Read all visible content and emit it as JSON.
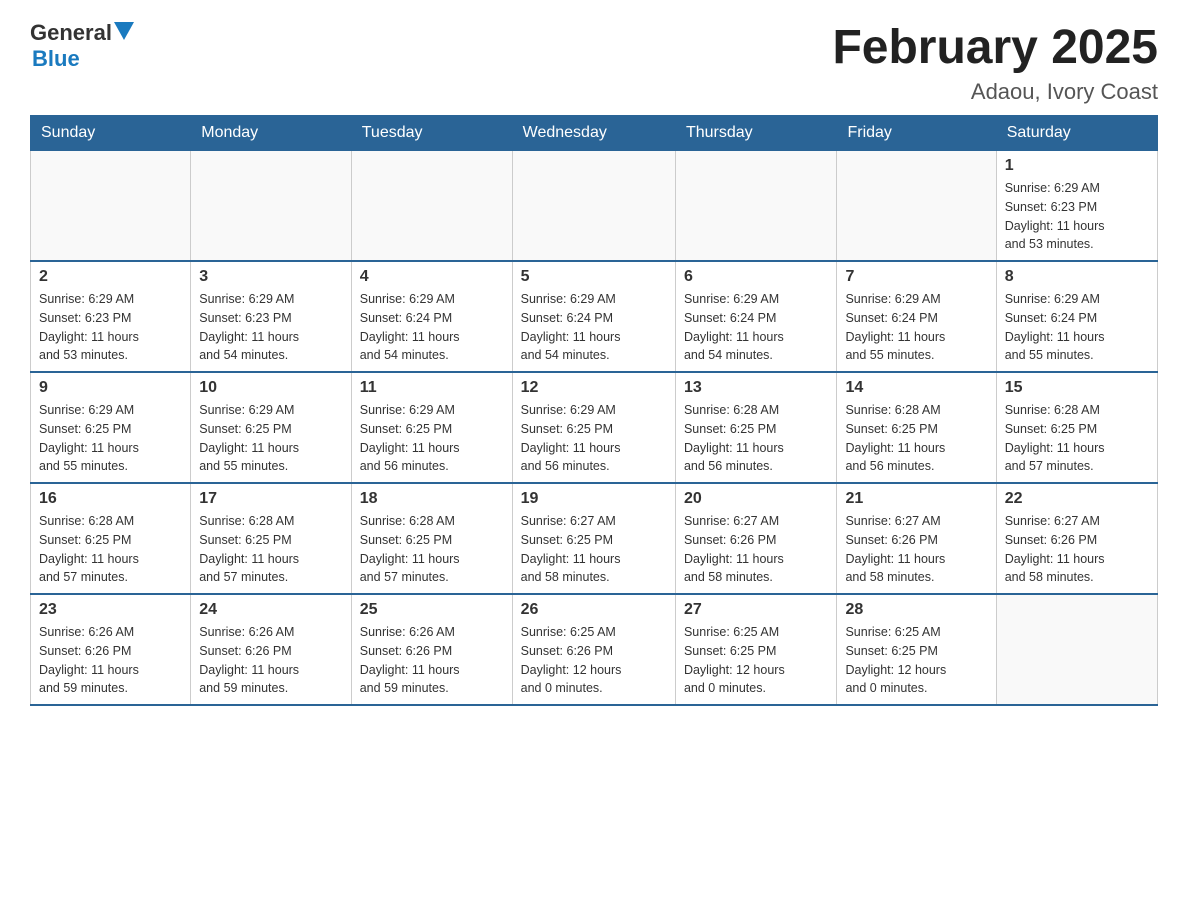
{
  "header": {
    "logo_general": "General",
    "logo_blue": "Blue",
    "month_title": "February 2025",
    "subtitle": "Adaou, Ivory Coast"
  },
  "weekdays": [
    "Sunday",
    "Monday",
    "Tuesday",
    "Wednesday",
    "Thursday",
    "Friday",
    "Saturday"
  ],
  "weeks": [
    [
      {
        "day": "",
        "info": ""
      },
      {
        "day": "",
        "info": ""
      },
      {
        "day": "",
        "info": ""
      },
      {
        "day": "",
        "info": ""
      },
      {
        "day": "",
        "info": ""
      },
      {
        "day": "",
        "info": ""
      },
      {
        "day": "1",
        "info": "Sunrise: 6:29 AM\nSunset: 6:23 PM\nDaylight: 11 hours\nand 53 minutes."
      }
    ],
    [
      {
        "day": "2",
        "info": "Sunrise: 6:29 AM\nSunset: 6:23 PM\nDaylight: 11 hours\nand 53 minutes."
      },
      {
        "day": "3",
        "info": "Sunrise: 6:29 AM\nSunset: 6:23 PM\nDaylight: 11 hours\nand 54 minutes."
      },
      {
        "day": "4",
        "info": "Sunrise: 6:29 AM\nSunset: 6:24 PM\nDaylight: 11 hours\nand 54 minutes."
      },
      {
        "day": "5",
        "info": "Sunrise: 6:29 AM\nSunset: 6:24 PM\nDaylight: 11 hours\nand 54 minutes."
      },
      {
        "day": "6",
        "info": "Sunrise: 6:29 AM\nSunset: 6:24 PM\nDaylight: 11 hours\nand 54 minutes."
      },
      {
        "day": "7",
        "info": "Sunrise: 6:29 AM\nSunset: 6:24 PM\nDaylight: 11 hours\nand 55 minutes."
      },
      {
        "day": "8",
        "info": "Sunrise: 6:29 AM\nSunset: 6:24 PM\nDaylight: 11 hours\nand 55 minutes."
      }
    ],
    [
      {
        "day": "9",
        "info": "Sunrise: 6:29 AM\nSunset: 6:25 PM\nDaylight: 11 hours\nand 55 minutes."
      },
      {
        "day": "10",
        "info": "Sunrise: 6:29 AM\nSunset: 6:25 PM\nDaylight: 11 hours\nand 55 minutes."
      },
      {
        "day": "11",
        "info": "Sunrise: 6:29 AM\nSunset: 6:25 PM\nDaylight: 11 hours\nand 56 minutes."
      },
      {
        "day": "12",
        "info": "Sunrise: 6:29 AM\nSunset: 6:25 PM\nDaylight: 11 hours\nand 56 minutes."
      },
      {
        "day": "13",
        "info": "Sunrise: 6:28 AM\nSunset: 6:25 PM\nDaylight: 11 hours\nand 56 minutes."
      },
      {
        "day": "14",
        "info": "Sunrise: 6:28 AM\nSunset: 6:25 PM\nDaylight: 11 hours\nand 56 minutes."
      },
      {
        "day": "15",
        "info": "Sunrise: 6:28 AM\nSunset: 6:25 PM\nDaylight: 11 hours\nand 57 minutes."
      }
    ],
    [
      {
        "day": "16",
        "info": "Sunrise: 6:28 AM\nSunset: 6:25 PM\nDaylight: 11 hours\nand 57 minutes."
      },
      {
        "day": "17",
        "info": "Sunrise: 6:28 AM\nSunset: 6:25 PM\nDaylight: 11 hours\nand 57 minutes."
      },
      {
        "day": "18",
        "info": "Sunrise: 6:28 AM\nSunset: 6:25 PM\nDaylight: 11 hours\nand 57 minutes."
      },
      {
        "day": "19",
        "info": "Sunrise: 6:27 AM\nSunset: 6:25 PM\nDaylight: 11 hours\nand 58 minutes."
      },
      {
        "day": "20",
        "info": "Sunrise: 6:27 AM\nSunset: 6:26 PM\nDaylight: 11 hours\nand 58 minutes."
      },
      {
        "day": "21",
        "info": "Sunrise: 6:27 AM\nSunset: 6:26 PM\nDaylight: 11 hours\nand 58 minutes."
      },
      {
        "day": "22",
        "info": "Sunrise: 6:27 AM\nSunset: 6:26 PM\nDaylight: 11 hours\nand 58 minutes."
      }
    ],
    [
      {
        "day": "23",
        "info": "Sunrise: 6:26 AM\nSunset: 6:26 PM\nDaylight: 11 hours\nand 59 minutes."
      },
      {
        "day": "24",
        "info": "Sunrise: 6:26 AM\nSunset: 6:26 PM\nDaylight: 11 hours\nand 59 minutes."
      },
      {
        "day": "25",
        "info": "Sunrise: 6:26 AM\nSunset: 6:26 PM\nDaylight: 11 hours\nand 59 minutes."
      },
      {
        "day": "26",
        "info": "Sunrise: 6:25 AM\nSunset: 6:26 PM\nDaylight: 12 hours\nand 0 minutes."
      },
      {
        "day": "27",
        "info": "Sunrise: 6:25 AM\nSunset: 6:25 PM\nDaylight: 12 hours\nand 0 minutes."
      },
      {
        "day": "28",
        "info": "Sunrise: 6:25 AM\nSunset: 6:25 PM\nDaylight: 12 hours\nand 0 minutes."
      },
      {
        "day": "",
        "info": ""
      }
    ]
  ]
}
